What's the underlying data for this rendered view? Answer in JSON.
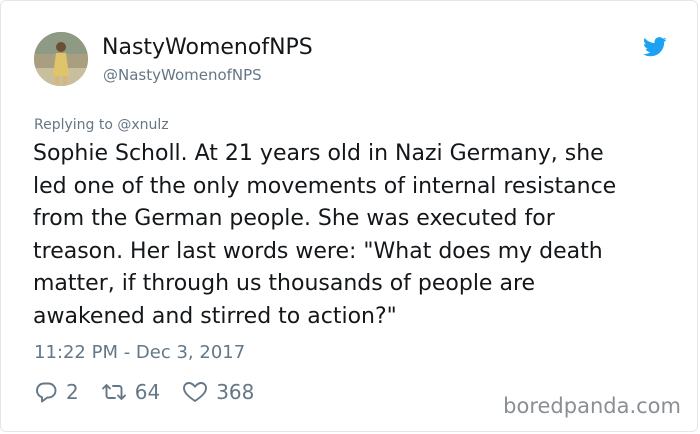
{
  "tweet": {
    "display_name": "NastyWomenofNPS",
    "handle": "@NastyWomenofNPS",
    "reply_prefix": "Replying to ",
    "reply_mention": "@xnulz",
    "text": "Sophie Scholl. At 21 years old in Nazi Germany, she\nled one of the only movements of internal resistance\nfrom the German people. She was executed for\ntreason. Her last words were: \"What does my death\nmatter, if through us thousands of people are\nawakened and stirred to action?\"",
    "timestamp": "11:22 PM - Dec 3, 2017",
    "replies": "2",
    "retweets": "64",
    "likes": "368"
  },
  "icons": {
    "brand": "twitter-bird-icon",
    "reply": "reply-icon",
    "retweet": "retweet-icon",
    "like": "heart-icon"
  },
  "colors": {
    "twitter_blue": "#1da1f2",
    "text": "#14171a",
    "secondary": "#657786",
    "border": "#e1e8ed"
  },
  "watermark": "boredpanda.com"
}
